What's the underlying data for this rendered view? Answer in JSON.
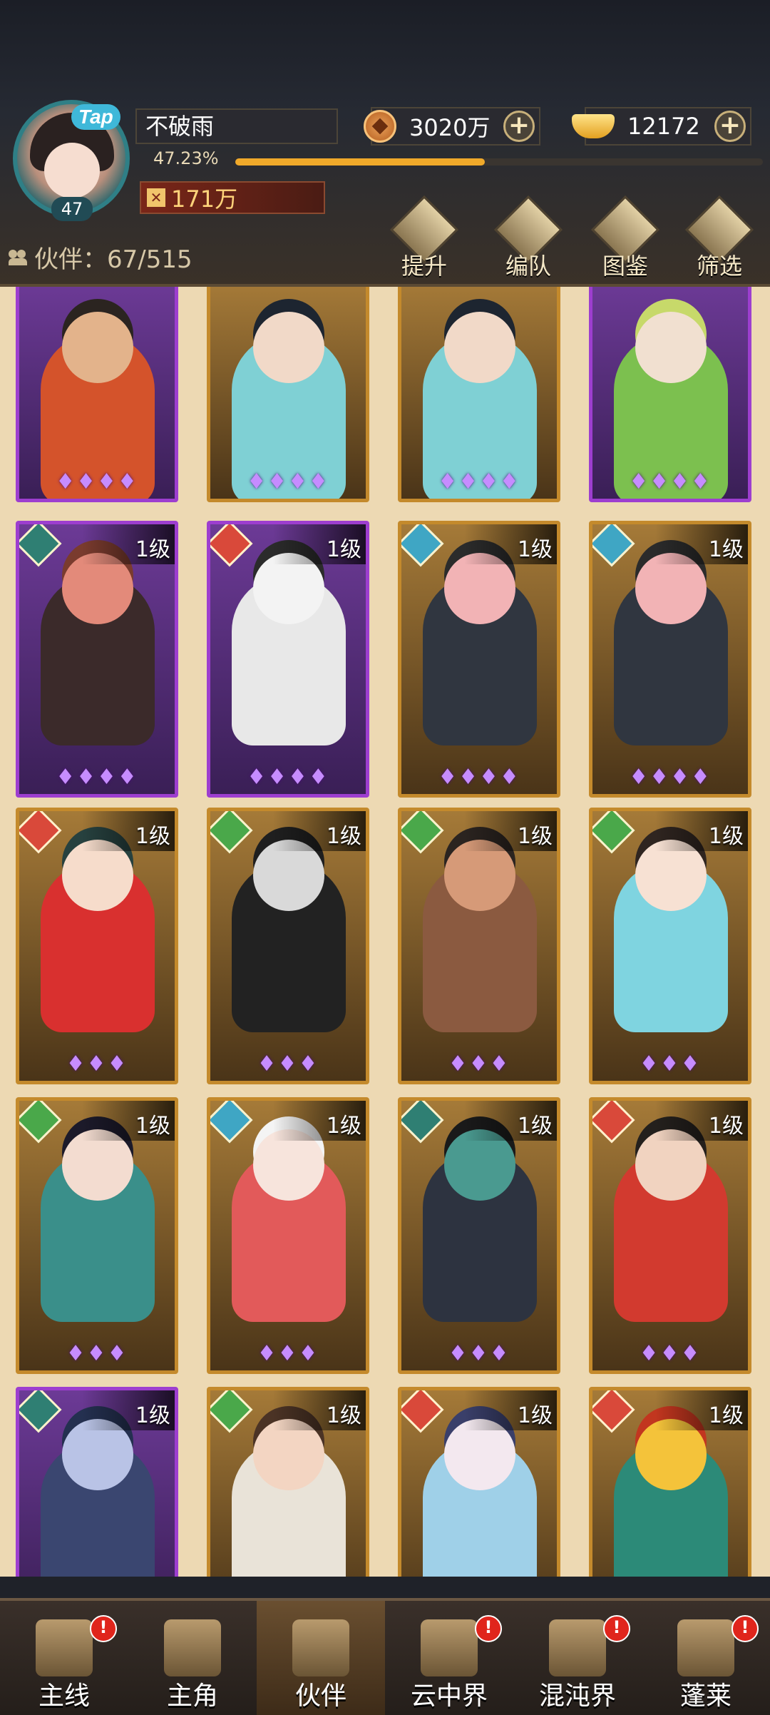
{
  "player": {
    "name": "不破雨",
    "avatar_level": "47",
    "tap_badge": "Tap",
    "exp_percent_text": "47.23%",
    "exp_fraction": 0.4723,
    "combat_power": "171万"
  },
  "currencies": {
    "copper": {
      "value": "3020万",
      "icon": "copper-coin-icon"
    },
    "gold": {
      "value": "12172",
      "icon": "gold-ingot-icon"
    }
  },
  "partners": {
    "count_label": "伙伴：67/515"
  },
  "toolbar": {
    "upgrade": "提升",
    "formation": "编队",
    "catalog": "图鉴",
    "filter": "筛选"
  },
  "cards": [
    {
      "frame": "purple",
      "element": "",
      "level": "",
      "stars": 4,
      "skin": "#e3b38b",
      "hair": "#2b2420",
      "cloth": "#d4532b"
    },
    {
      "frame": "gold",
      "element": "",
      "level": "",
      "stars": 4,
      "skin": "#f1d9c8",
      "hair": "#1d2530",
      "cloth": "#7fd0d4"
    },
    {
      "frame": "gold",
      "element": "",
      "level": "",
      "stars": 4,
      "skin": "#f1d9c8",
      "hair": "#1d2530",
      "cloth": "#7fd0d4"
    },
    {
      "frame": "purple",
      "element": "",
      "level": "",
      "stars": 4,
      "skin": "#f1e0d0",
      "hair": "#c7d96a",
      "cloth": "#7cc04f"
    },
    {
      "frame": "purple",
      "element": "dark",
      "level": "1级",
      "stars": 4,
      "skin": "#e38a7a",
      "hair": "#7a3b2e",
      "cloth": "#3b2a2a"
    },
    {
      "frame": "purple",
      "element": "fire",
      "level": "1级",
      "stars": 4,
      "skin": "#f3f3f3",
      "hair": "#2b2b2b",
      "cloth": "#e8e8e8"
    },
    {
      "frame": "gold",
      "element": "water",
      "level": "1级",
      "stars": 4,
      "skin": "#f2b3b5",
      "hair": "#2b2b2b",
      "cloth": "#303640"
    },
    {
      "frame": "gold",
      "element": "water",
      "level": "1级",
      "stars": 4,
      "skin": "#f2b3b5",
      "hair": "#2b2b2b",
      "cloth": "#303640"
    },
    {
      "frame": "gold",
      "element": "fire",
      "level": "1级",
      "stars": 3,
      "skin": "#f6dccb",
      "hair": "#27413f",
      "cloth": "#d9302f"
    },
    {
      "frame": "gold",
      "element": "wind",
      "level": "1级",
      "stars": 3,
      "skin": "#d9d9d9",
      "hair": "#1f1f1f",
      "cloth": "#222"
    },
    {
      "frame": "gold",
      "element": "wind",
      "level": "1级",
      "stars": 3,
      "skin": "#d69a78",
      "hair": "#2b2420",
      "cloth": "#8b5a40"
    },
    {
      "frame": "gold",
      "element": "wind",
      "level": "1级",
      "stars": 3,
      "skin": "#f7e1d3",
      "hair": "#2f2520",
      "cloth": "#7fd4e0"
    },
    {
      "frame": "gold",
      "element": "wind",
      "level": "1级",
      "stars": 3,
      "skin": "#f3dcd0",
      "hair": "#1c1a2a",
      "cloth": "#3a8f8a"
    },
    {
      "frame": "gold",
      "element": "water",
      "level": "1级",
      "stars": 3,
      "skin": "#f7e4dc",
      "hair": "#f4f4f4",
      "cloth": "#e25a5a"
    },
    {
      "frame": "gold",
      "element": "dark",
      "level": "1级",
      "stars": 3,
      "skin": "#4a9a90",
      "hair": "#1a1a1a",
      "cloth": "#2d3340"
    },
    {
      "frame": "gold",
      "element": "fire",
      "level": "1级",
      "stars": 3,
      "skin": "#f1d3c0",
      "hair": "#24201d",
      "cloth": "#d23a2f"
    },
    {
      "frame": "purple",
      "element": "dark",
      "level": "1级",
      "stars": 0,
      "skin": "#b9c3e6",
      "hair": "#243050",
      "cloth": "#3a4670"
    },
    {
      "frame": "gold",
      "element": "wind",
      "level": "1级",
      "stars": 0,
      "skin": "#f3d5c2",
      "hair": "#4b3325",
      "cloth": "#e9e3d8"
    },
    {
      "frame": "gold",
      "element": "fire",
      "level": "1级",
      "stars": 0,
      "skin": "#f3e8ef",
      "hair": "#3a3f6a",
      "cloth": "#9fd0e8"
    },
    {
      "frame": "gold",
      "element": "fire",
      "level": "1级",
      "stars": 0,
      "skin": "#f4c33a",
      "hair": "#c2361f",
      "cloth": "#2c8a78"
    }
  ],
  "element_colors": {
    "dark": "#2f7f73",
    "fire": "#d9493a",
    "water": "#3fa6c4",
    "wind": "#4aa84a"
  },
  "nav": [
    {
      "label": "主线",
      "alert": "!",
      "active": false
    },
    {
      "label": "主角",
      "alert": "",
      "active": false
    },
    {
      "label": "伙伴",
      "alert": "",
      "active": true
    },
    {
      "label": "云中界",
      "alert": "!",
      "active": false
    },
    {
      "label": "混沌界",
      "alert": "!",
      "active": false
    },
    {
      "label": "蓬莱",
      "alert": "!",
      "active": false
    }
  ]
}
